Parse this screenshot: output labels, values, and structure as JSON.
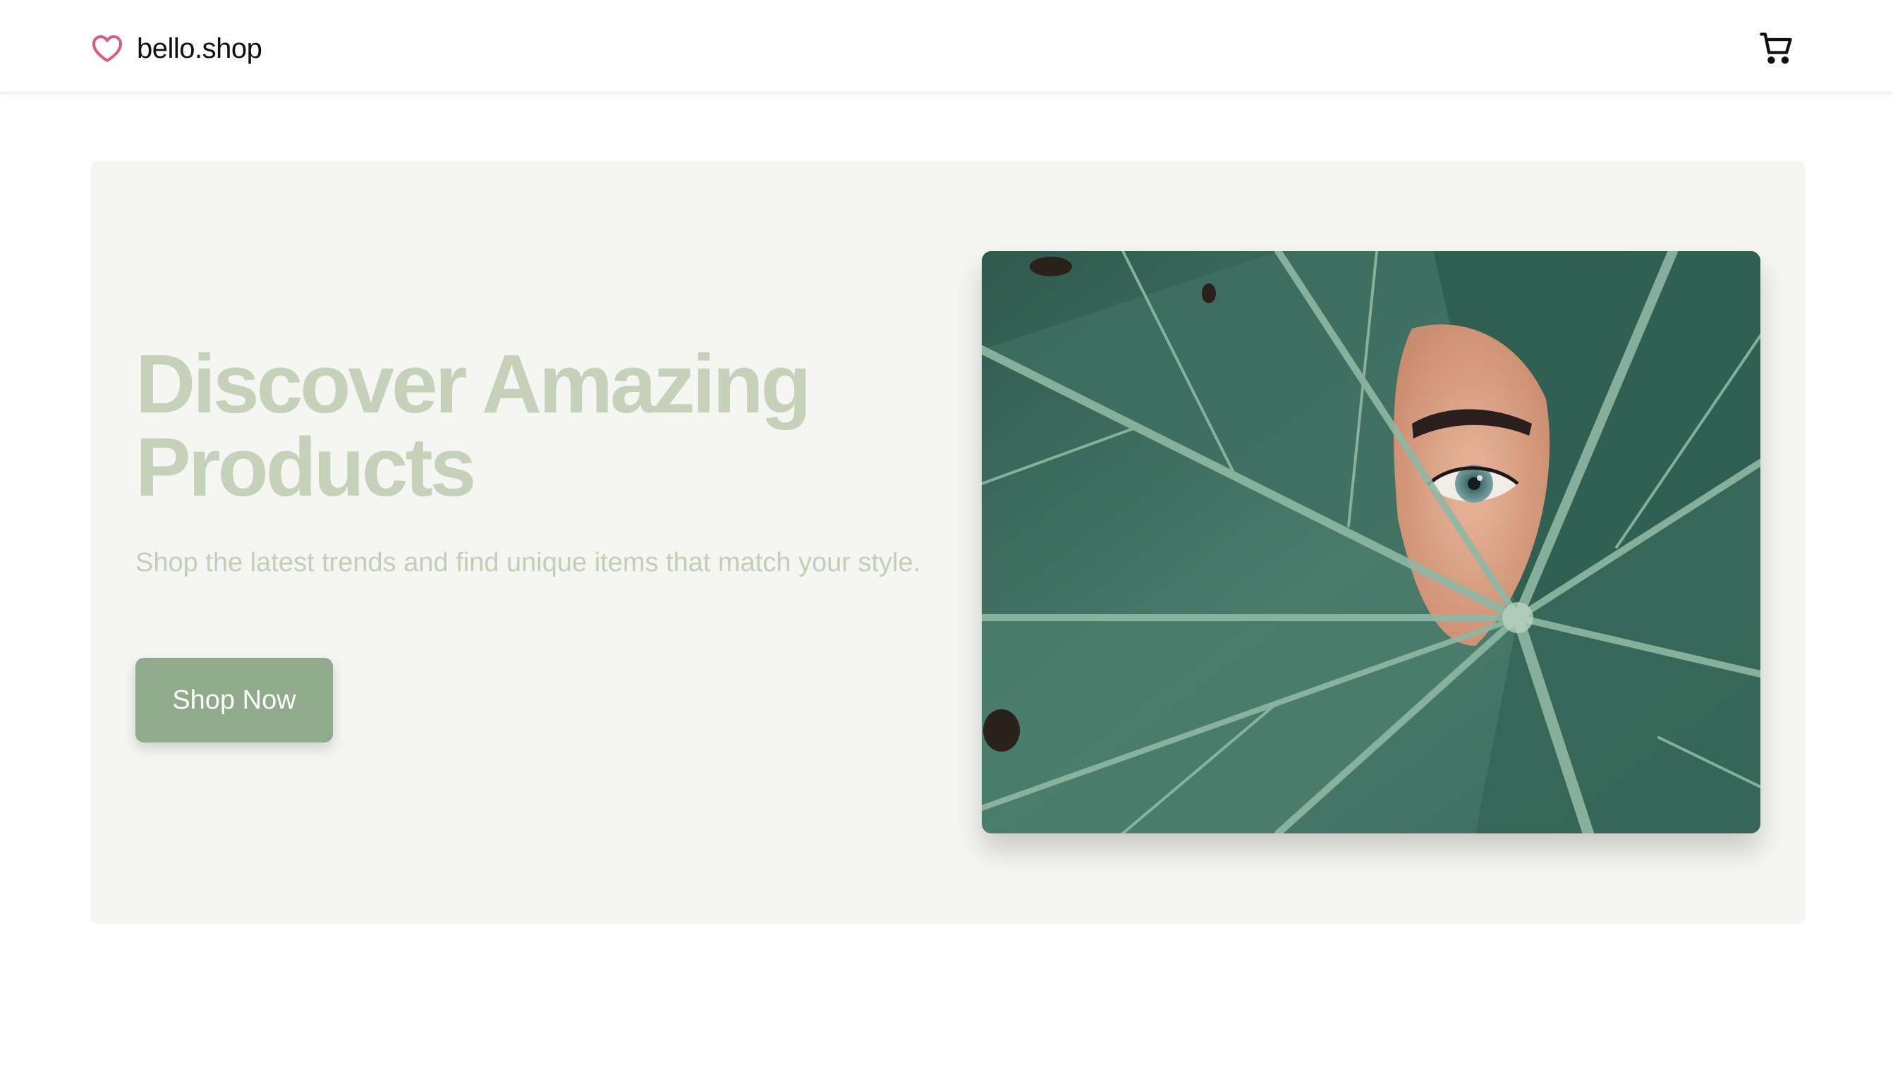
{
  "header": {
    "brand_name": "bello.shop",
    "brand_icon": "heart-icon",
    "cart_icon": "cart-icon"
  },
  "hero": {
    "title": "Discover Amazing Products",
    "subtitle": "Shop the latest trends and find unique items that match your style.",
    "cta_label": "Shop Now",
    "image_alt": "eye-behind-leaf-photo"
  },
  "colors": {
    "brand_heart": "#e0587e",
    "hero_background": "#f5f6f2",
    "title_text": "#c6d1b9",
    "subtitle_text": "#c3ceb6",
    "button_background": "#8fab8c",
    "button_text": "#ffffff"
  }
}
